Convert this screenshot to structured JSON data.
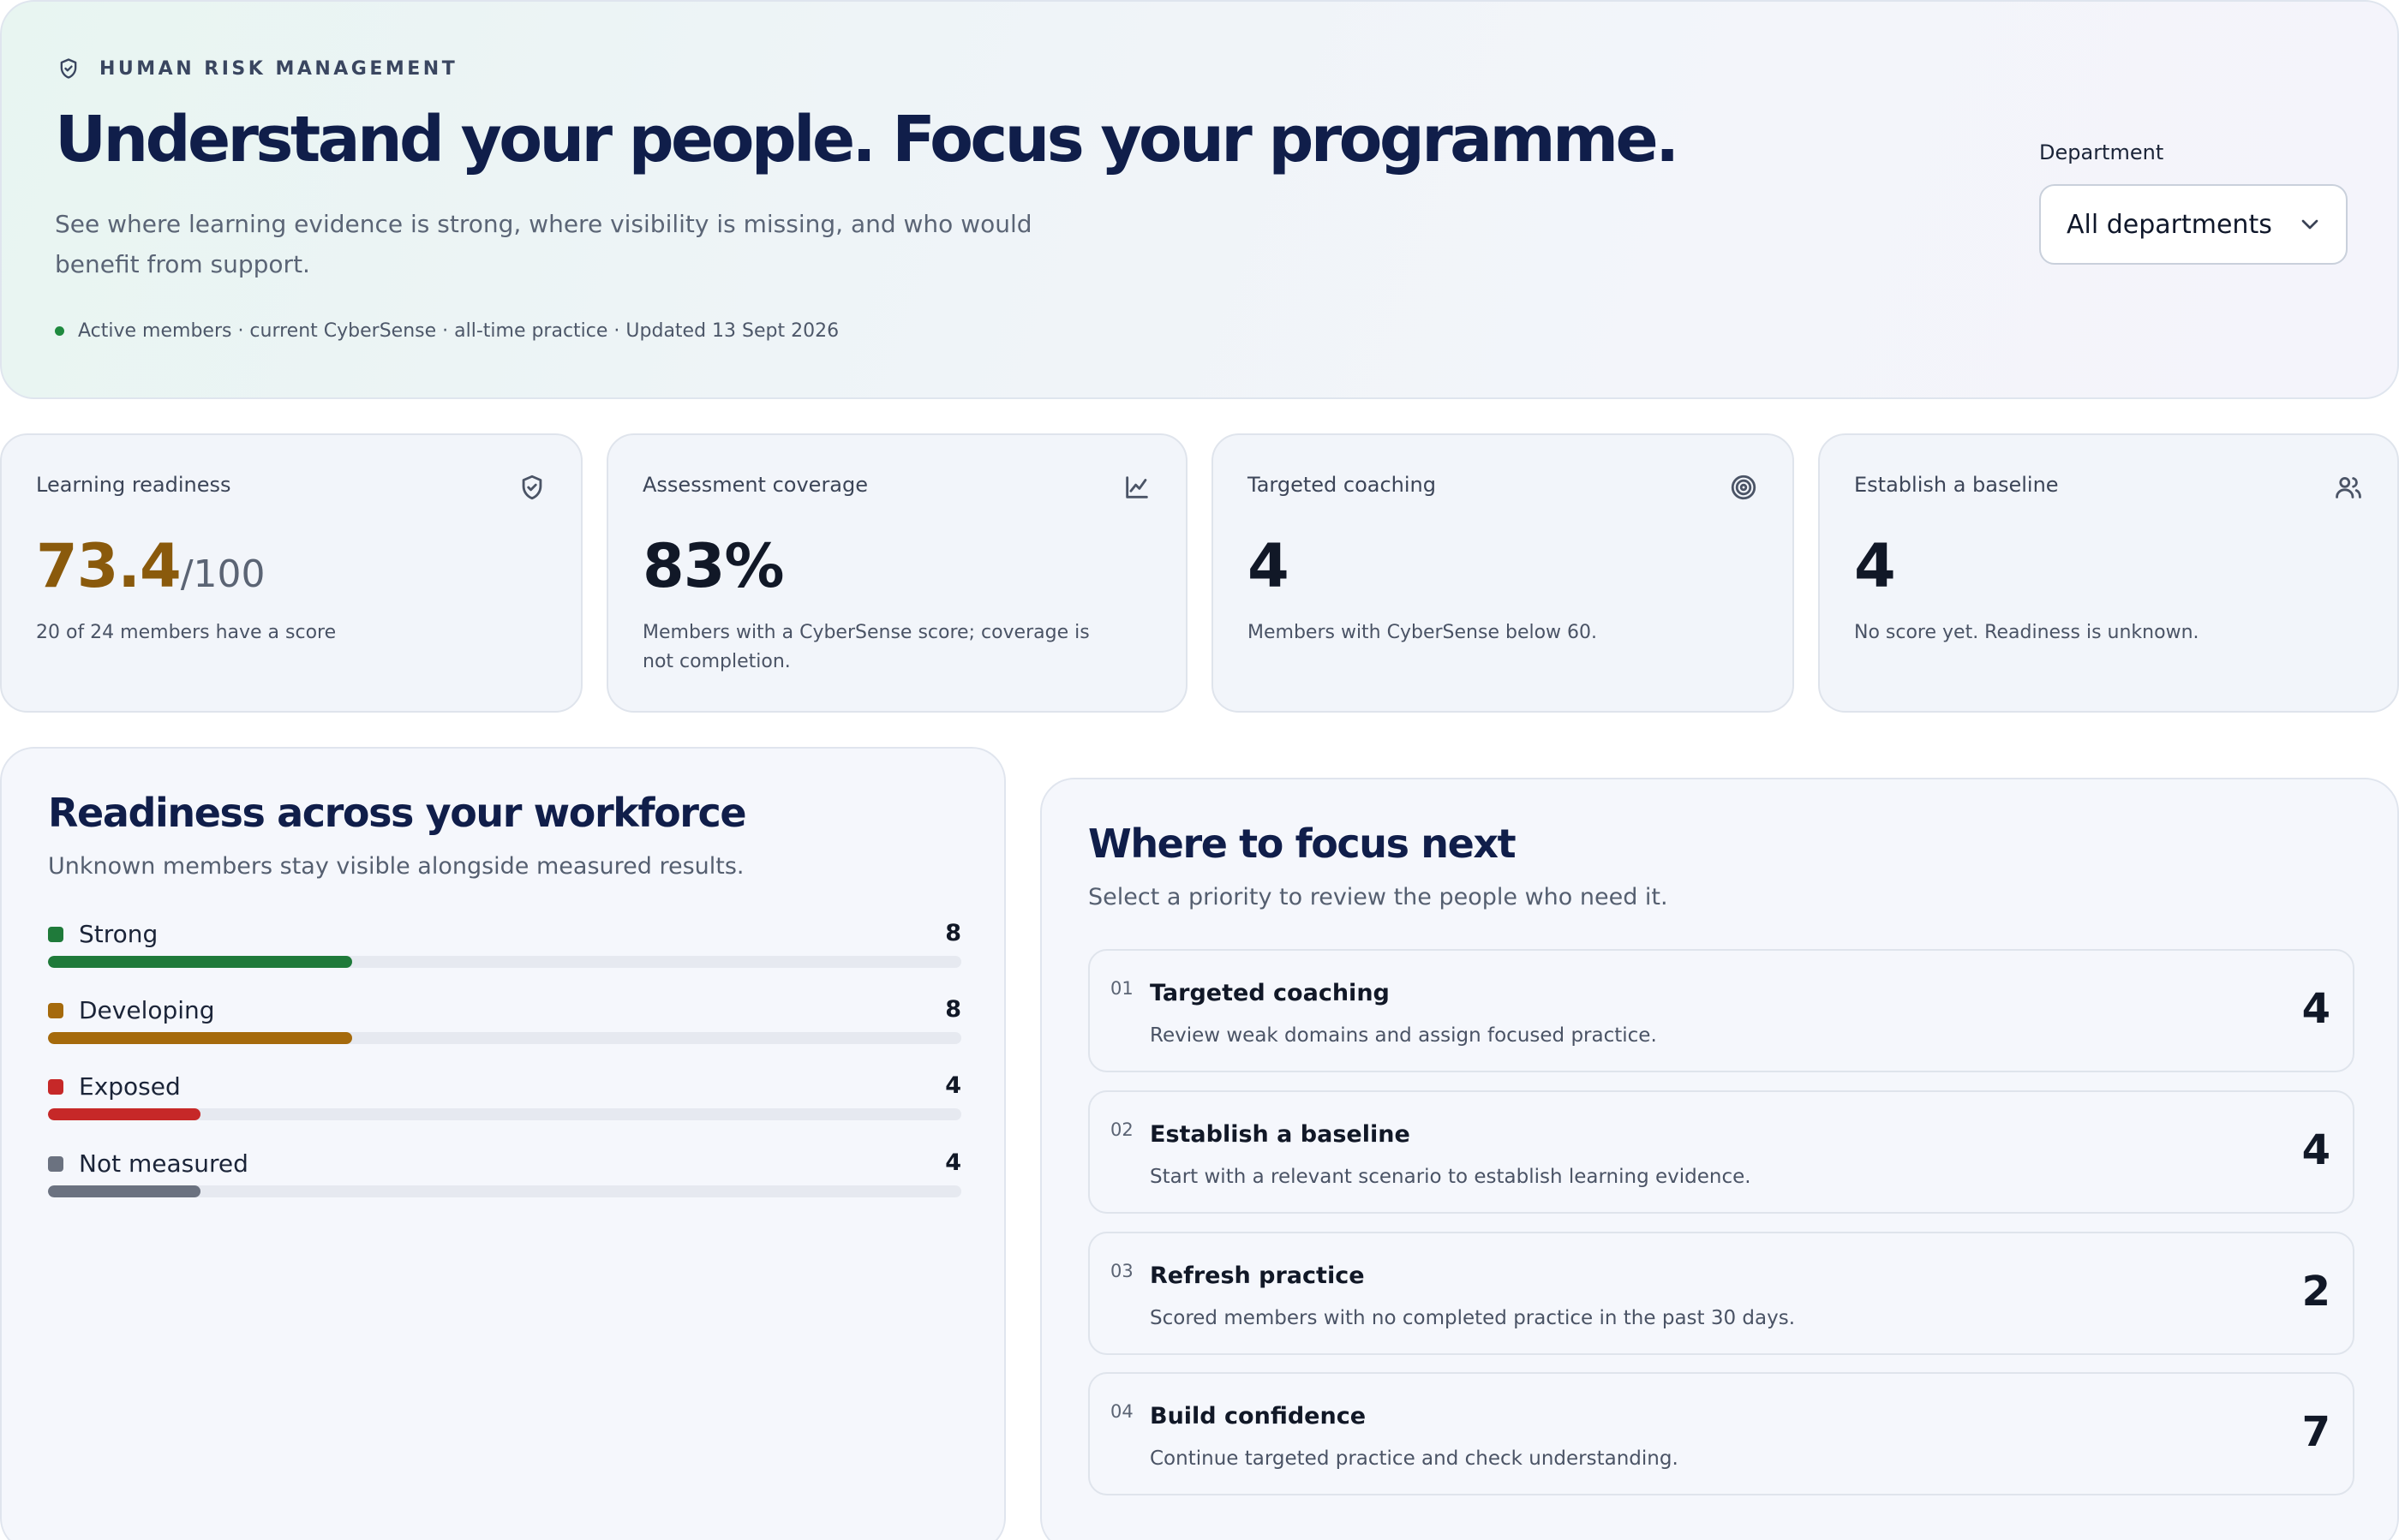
{
  "hero": {
    "eyebrow": "HUMAN RISK MANAGEMENT",
    "title": "Understand your people. Focus your programme.",
    "subtitle": "See where learning evidence is strong, where visibility is missing, and who would benefit from support.",
    "meta": "Active members · current CyberSense · all-time practice · Updated 13 Sept 2026",
    "meta_status_color": "#1f8a3f",
    "icon": "shield-check-icon"
  },
  "department": {
    "label": "Department",
    "selected": "All departments",
    "icon": "chevron-down-icon"
  },
  "cards": [
    {
      "title": "Learning readiness",
      "value": "73.4",
      "suffix": "/100",
      "desc": "20 of 24 members have a score",
      "icon": "shield-check-icon",
      "accent": "#8a5a0c"
    },
    {
      "title": "Assessment coverage",
      "value": "83%",
      "desc": "Members with a CyberSense score; coverage is not completion.",
      "icon": "line-chart-icon"
    },
    {
      "title": "Targeted coaching",
      "value": "4",
      "desc": "Members with CyberSense below 60.",
      "icon": "target-icon"
    },
    {
      "title": "Establish a baseline",
      "value": "4",
      "desc": "No score yet. Readiness is unknown.",
      "icon": "users-icon"
    }
  ],
  "readiness": {
    "title": "Readiness across your workforce",
    "subtitle": "Unknown members stay visible alongside measured results.",
    "total": 24,
    "rows": [
      {
        "label": "Strong",
        "count": 8,
        "color": "#1f7a3a"
      },
      {
        "label": "Developing",
        "count": 8,
        "color": "#a56a0c"
      },
      {
        "label": "Exposed",
        "count": 4,
        "color": "#c62828"
      },
      {
        "label": "Not measured",
        "count": 4,
        "color": "#6b7280"
      }
    ]
  },
  "focus": {
    "title": "Where to focus next",
    "subtitle": "Select a priority to review the people who need it.",
    "items": [
      {
        "num": "01",
        "title": "Targeted coaching",
        "desc": "Review weak domains and assign focused practice.",
        "count": "4"
      },
      {
        "num": "02",
        "title": "Establish a baseline",
        "desc": "Start with a relevant scenario to establish learning evidence.",
        "count": "4"
      },
      {
        "num": "03",
        "title": "Refresh practice",
        "desc": "Scored members with no completed practice in the past 30 days.",
        "count": "2"
      },
      {
        "num": "04",
        "title": "Build confidence",
        "desc": "Continue targeted practice and check understanding.",
        "count": "7"
      }
    ]
  }
}
